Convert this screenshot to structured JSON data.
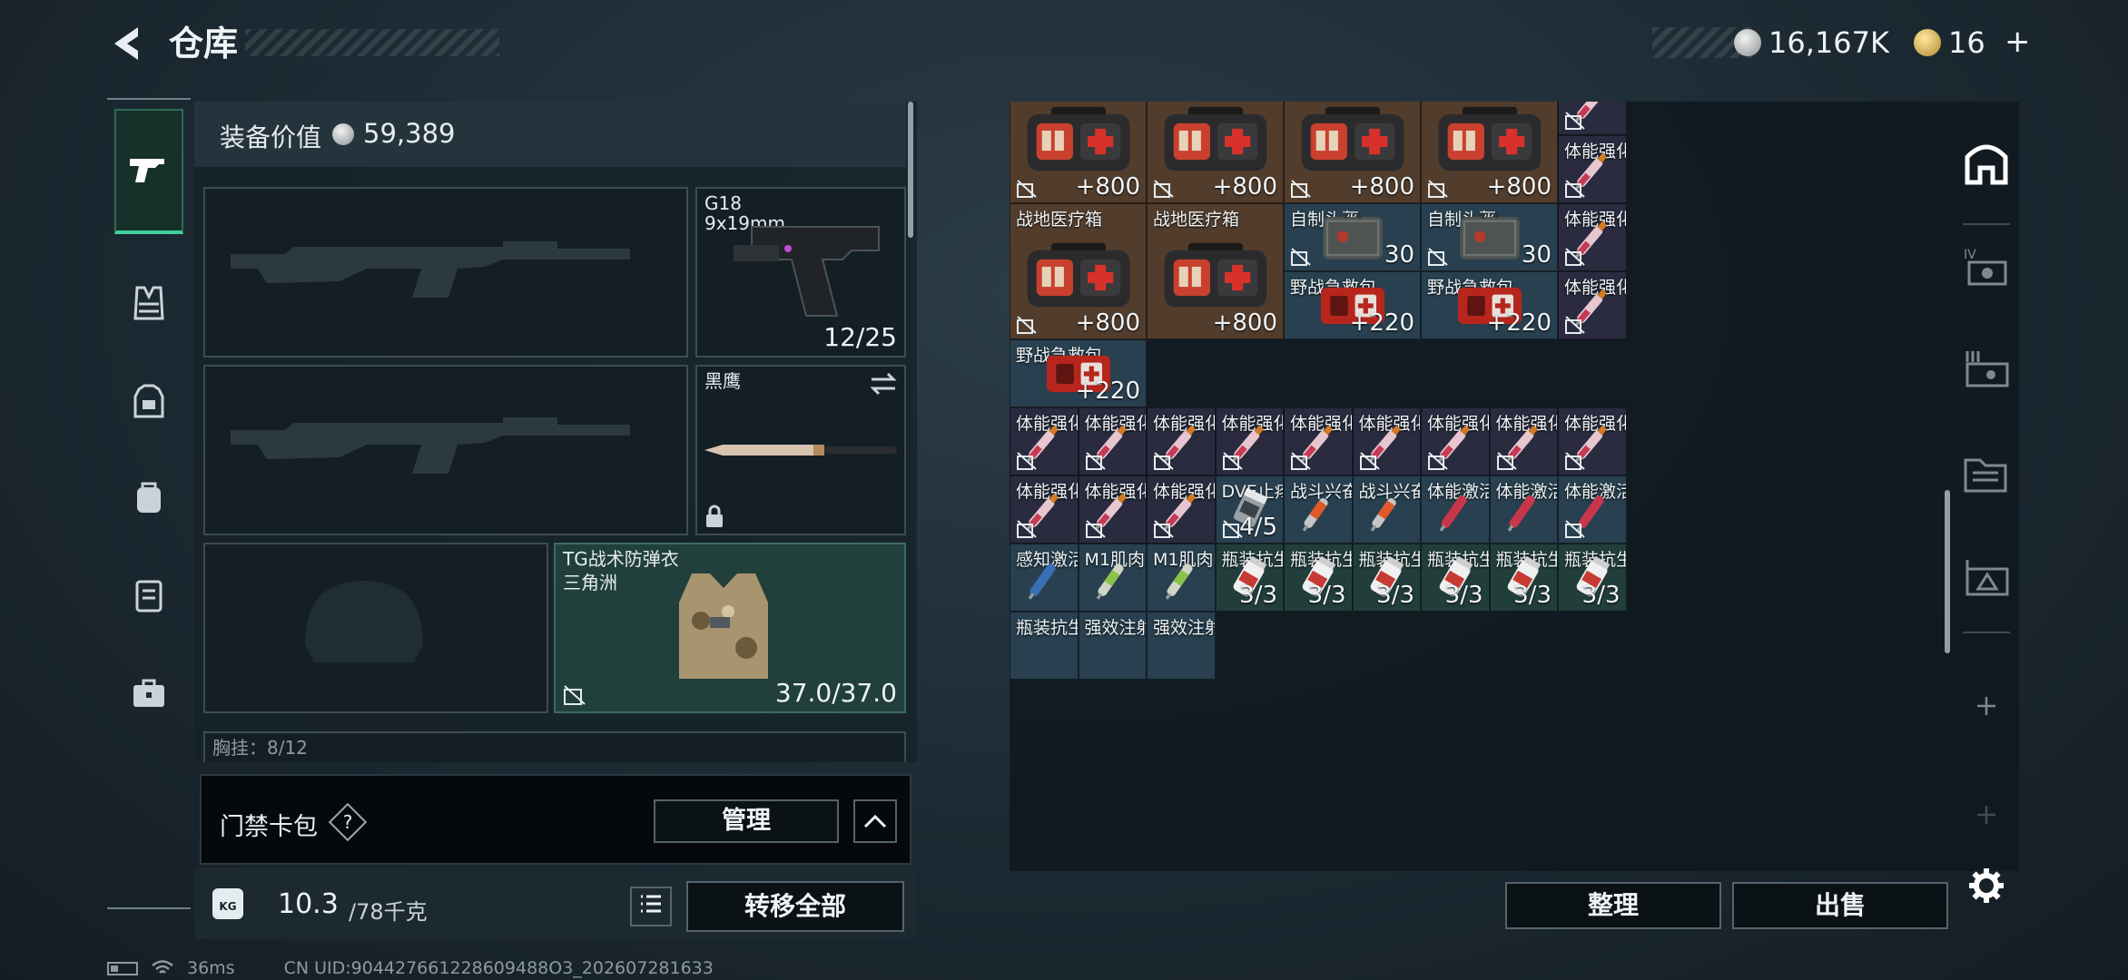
{
  "header": {
    "title": "仓库",
    "silver": "16,167K",
    "gold": "16"
  },
  "loadout": {
    "value_label": "装备价值",
    "value": "59,389",
    "pistol": {
      "name": "G18",
      "caliber": "9x19mm",
      "ammo": "12/25"
    },
    "melee": {
      "name": "黑鹰"
    },
    "armor": {
      "name": "TG战术防弹衣",
      "sub": "三角洲",
      "durability": "37.0/37.0"
    },
    "chest_partial": "胸挂：8/12"
  },
  "keycard": {
    "label": "门禁卡包",
    "help": "?",
    "manage": "管理"
  },
  "weight": {
    "value": "10.3",
    "limit": "/78千克",
    "move_all": "转移全部",
    "kg": "KG"
  },
  "status": {
    "ping": "36ms",
    "uid": "CN UID:904427661228609488O3_202607281633"
  },
  "grid": {
    "sort": "整理",
    "sell": "出售",
    "cells": [
      {
        "name": "",
        "qty": "+800",
        "color": "brown",
        "item": "firstaid",
        "lock": true
      },
      {
        "name": "战地医疗箱",
        "qty": "+800",
        "color": "brown",
        "item": "firstaid",
        "lock": true
      },
      {
        "name": "战地医疗箱",
        "qty": "+800",
        "color": "brown",
        "item": "firstaid",
        "lock": true
      },
      {
        "name": "战地医疗箱",
        "qty": "+800",
        "color": "brown",
        "item": "firstaid",
        "lock": true
      },
      {
        "name": "体能强化剂",
        "qty": "",
        "color": "purple",
        "item": "syringe",
        "lock": true
      },
      {
        "name": "体能强化剂",
        "qty": "",
        "color": "purple",
        "item": "syringe",
        "lock": true
      },
      {
        "name": "战地医疗箱",
        "qty": "+800",
        "color": "brown",
        "item": "firstaid",
        "lock": true
      },
      {
        "name": "自制头盔",
        "qty": "30",
        "color": "blue",
        "item": "helmet",
        "lock": true
      },
      {
        "name": "自制头盔",
        "qty": "30",
        "color": "blue",
        "item": "helmet",
        "lock": true
      },
      {
        "name": "体能强化剂",
        "qty": "",
        "color": "purple",
        "item": "syringe",
        "lock": true
      },
      {
        "name": "野战急救包",
        "qty": "+220",
        "color": "blue",
        "item": "redkit",
        "lock": false
      },
      {
        "name": "战地医疗箱",
        "qty": "+800",
        "color": "brown",
        "item": "firstaid",
        "lock": false
      },
      {
        "name": "野战急救包",
        "qty": "+220",
        "color": "blue",
        "item": "redkit",
        "lock": false
      },
      {
        "name": "野战急救包",
        "qty": "+220",
        "color": "blue",
        "item": "redkit",
        "lock": false
      },
      {
        "name": "体能强化剂",
        "qty": "",
        "color": "purple",
        "item": "syringe",
        "lock": true
      },
      {
        "name": "体能强化剂",
        "qty": "",
        "color": "purple",
        "item": "syringe",
        "lock": true
      },
      {
        "name": "体能强化剂",
        "qty": "",
        "color": "purple",
        "item": "syringe",
        "lock": true
      },
      {
        "name": "体能强化剂",
        "qty": "",
        "color": "purple",
        "item": "syringe",
        "lock": true
      },
      {
        "name": "体能强化剂",
        "qty": "",
        "color": "purple",
        "item": "syringe",
        "lock": true
      },
      {
        "name": "体能强化剂",
        "qty": "",
        "color": "purple",
        "item": "syringe",
        "lock": true
      },
      {
        "name": "体能强化剂",
        "qty": "",
        "color": "purple",
        "item": "syringe",
        "lock": true
      },
      {
        "name": "体能强化剂",
        "qty": "",
        "color": "purple",
        "item": "syringe",
        "lock": true
      },
      {
        "name": "体能强化剂",
        "qty": "",
        "color": "purple",
        "item": "syringe",
        "lock": true
      },
      {
        "name": "体能强化剂",
        "qty": "",
        "color": "purple",
        "item": "syringe",
        "lock": true
      },
      {
        "name": "体能强化剂",
        "qty": "",
        "color": "purple",
        "item": "syringe",
        "lock": true
      },
      {
        "name": "体能强化剂",
        "qty": "",
        "color": "purple",
        "item": "syringe",
        "lock": true
      },
      {
        "name": "体能强化剂",
        "qty": "",
        "color": "purple",
        "item": "syringe",
        "lock": true
      },
      {
        "name": "DVE止疼片",
        "qty": "4/5",
        "color": "blue",
        "item": "pills",
        "lock": true
      },
      {
        "name": "战斗兴奋剂",
        "qty": "",
        "color": "blue",
        "item": "orange",
        "lock": false
      },
      {
        "name": "战斗兴奋剂",
        "qty": "",
        "color": "blue",
        "item": "orange",
        "lock": false
      },
      {
        "name": "体能激活针",
        "qty": "",
        "color": "blue",
        "item": "red",
        "lock": false
      },
      {
        "name": "体能激活针",
        "qty": "",
        "color": "blue",
        "item": "red",
        "lock": false
      },
      {
        "name": "体能激活针",
        "qty": "",
        "color": "blue",
        "item": "red",
        "lock": true
      },
      {
        "name": "感知激活针",
        "qty": "",
        "color": "blue",
        "item": "bluesyr",
        "lock": false
      },
      {
        "name": "M1肌肉...",
        "qty": "",
        "color": "blue",
        "item": "greensyr",
        "lock": false
      },
      {
        "name": "M1肌肉...",
        "qty": "",
        "color": "blue",
        "item": "greensyr",
        "lock": false
      },
      {
        "name": "瓶装抗生素",
        "qty": "3/3",
        "color": "green",
        "item": "bottle",
        "lock": false
      },
      {
        "name": "瓶装抗生素",
        "qty": "3/3",
        "color": "green",
        "item": "bottle",
        "lock": false
      },
      {
        "name": "瓶装抗生素",
        "qty": "3/3",
        "color": "green",
        "item": "bottle",
        "lock": false
      },
      {
        "name": "瓶装抗生素",
        "qty": "3/3",
        "color": "green",
        "item": "bottle",
        "lock": false
      },
      {
        "name": "瓶装抗生素",
        "qty": "3/3",
        "color": "green",
        "item": "bottle",
        "lock": false
      },
      {
        "name": "瓶装抗生素",
        "qty": "3/3",
        "color": "green",
        "item": "bottle",
        "lock": false
      },
      {
        "name": "瓶装抗生素",
        "qty": "",
        "color": "blue",
        "item": "none",
        "lock": false
      },
      {
        "name": "强效注射器",
        "qty": "",
        "color": "blue",
        "item": "none",
        "lock": false
      },
      {
        "name": "强效注射器",
        "qty": "",
        "color": "blue",
        "item": "none",
        "lock": false
      }
    ]
  },
  "colors": {
    "brown": "#523d2d",
    "blue": "#28404f",
    "purple": "#2a2b3f",
    "green": "#223e3b",
    "accent": "#3fd29a"
  },
  "icons": {
    "left_rail": [
      "pistol-icon",
      "vest-icon",
      "armor-icon",
      "backpack-icon",
      "chest-rig-icon",
      "briefcase-icon"
    ],
    "right_rail": [
      "home-icon",
      "iv-item-icon",
      "rifle-case-icon",
      "folder-icon",
      "warning-case-icon",
      "plus-icon",
      "plus-icon",
      "settings-icon"
    ]
  }
}
